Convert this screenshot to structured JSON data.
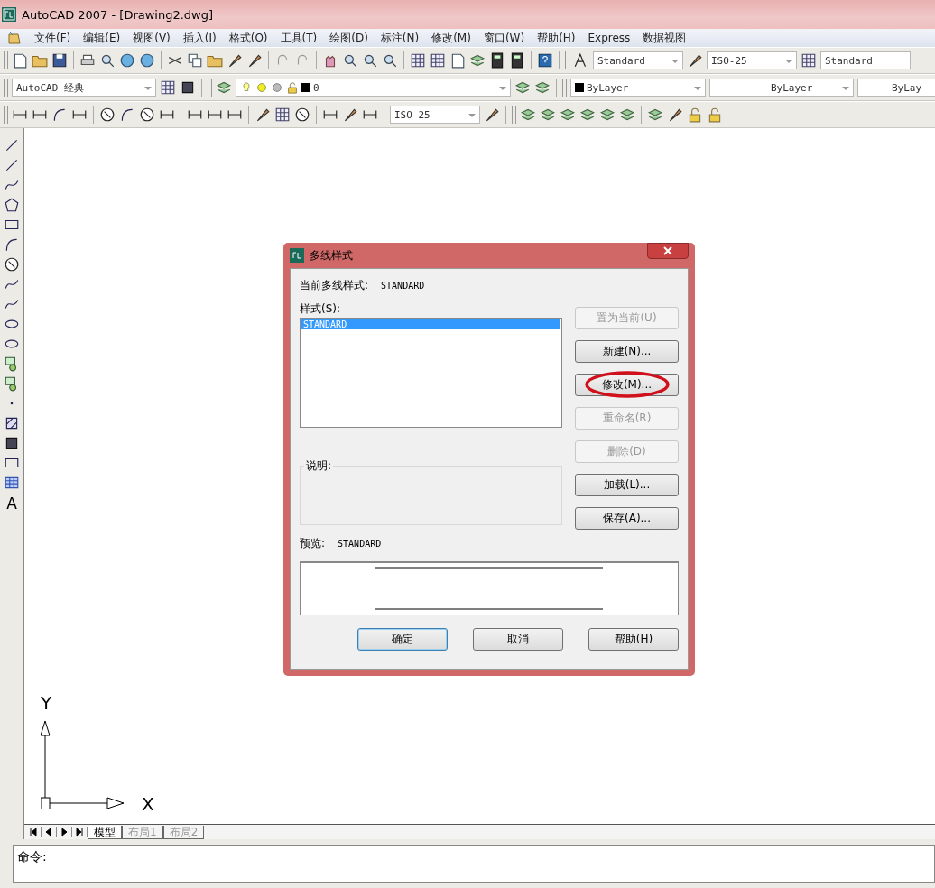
{
  "window": {
    "title": "AutoCAD 2007 - [Drawing2.dwg]"
  },
  "menu": [
    "文件(F)",
    "编辑(E)",
    "视图(V)",
    "插入(I)",
    "格式(O)",
    "工具(T)",
    "绘图(D)",
    "标注(N)",
    "修改(M)",
    "窗口(W)",
    "帮助(H)",
    "Express",
    "数据视图"
  ],
  "toolbars": {
    "text_style": "Standard",
    "dim_style": "ISO-25",
    "table_style": "Standard",
    "workspace": "AutoCAD 经典",
    "layer": "0",
    "color_control": "ByLayer",
    "linetype": "ByLayer",
    "lineweight": "ByLay",
    "dim_style_2": "ISO-25"
  },
  "left_toolbar": {
    "text_tool": "A"
  },
  "dialog": {
    "title": "多线样式",
    "current_label": "当前多线样式:",
    "current_value": "STANDARD",
    "styles_label": "样式(S):",
    "styles": [
      {
        "name": "STANDARD",
        "selected": true
      }
    ],
    "description_label": "说明:",
    "preview_label": "预览:",
    "preview_value": "STANDARD",
    "side_buttons": [
      {
        "label": "置为当前(U)",
        "disabled": true,
        "circled": false
      },
      {
        "label": "新建(N)...",
        "disabled": false,
        "circled": false
      },
      {
        "label": "修改(M)...",
        "disabled": false,
        "circled": true
      },
      {
        "label": "重命名(R)",
        "disabled": true,
        "circled": false
      },
      {
        "label": "删除(D)",
        "disabled": true,
        "circled": false
      },
      {
        "label": "加载(L)...",
        "disabled": false,
        "circled": false
      },
      {
        "label": "保存(A)...",
        "disabled": false,
        "circled": false
      }
    ],
    "bottom_buttons": [
      {
        "label": "确定",
        "default": true
      },
      {
        "label": "取消",
        "default": false
      },
      {
        "label": "帮助(H)",
        "default": false
      }
    ]
  },
  "ucs": {
    "y": "Y",
    "x": "X"
  },
  "layout_tabs": [
    {
      "label": "模型",
      "selected": true
    },
    {
      "label": "布局1",
      "selected": false
    },
    {
      "label": "布局2",
      "selected": false
    }
  ],
  "command": {
    "prompt": "命令:"
  }
}
